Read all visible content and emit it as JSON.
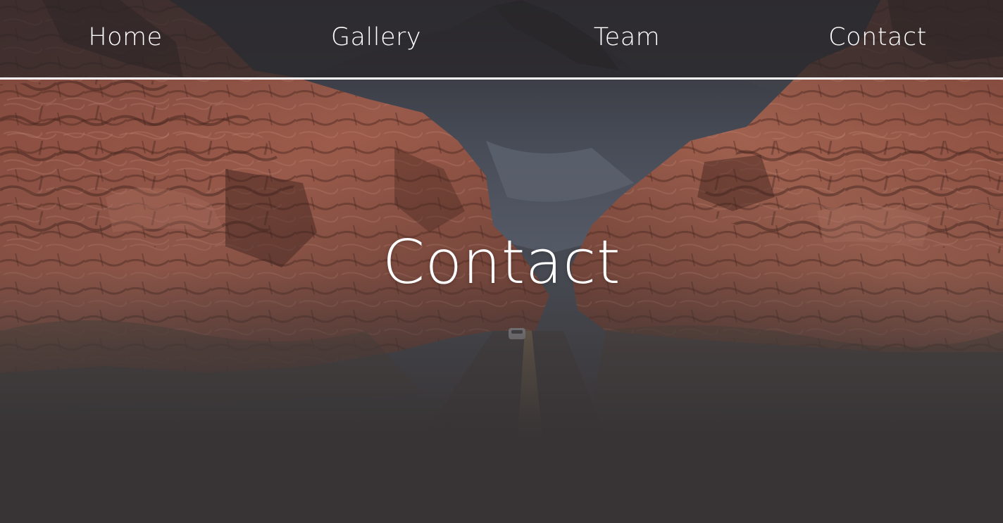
{
  "nav": {
    "items": [
      {
        "label": "Home"
      },
      {
        "label": "Gallery"
      },
      {
        "label": "Team"
      },
      {
        "label": "Contact"
      }
    ]
  },
  "hero": {
    "title": "Contact"
  },
  "colors": {
    "page_background": "#383435",
    "text": "#ffffff",
    "nav_border": "#ffffff",
    "rock": "#9c5a49"
  }
}
